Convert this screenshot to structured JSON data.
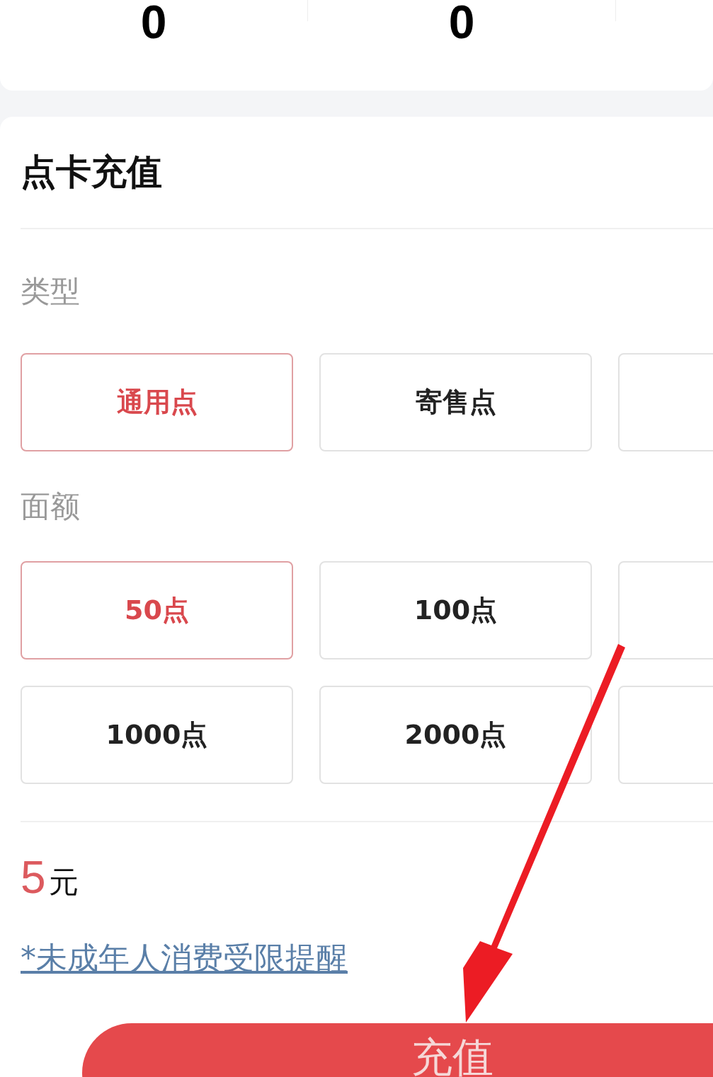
{
  "stats": [
    {
      "value": "0"
    },
    {
      "value": "0"
    }
  ],
  "recharge": {
    "title": "点卡充值",
    "type_label": "类型",
    "types": [
      {
        "label": "通用点",
        "selected": true
      },
      {
        "label": "寄售点",
        "selected": false
      },
      {
        "selected": false
      }
    ],
    "amount_label": "面额",
    "amounts": [
      {
        "label": "50点",
        "selected": true
      },
      {
        "label": "100点",
        "selected": false
      },
      {
        "selected": false
      },
      {
        "label": "1000点",
        "selected": false
      },
      {
        "label": "2000点",
        "selected": false
      },
      {
        "selected": false
      }
    ],
    "price": {
      "number": "5",
      "unit": "元"
    },
    "notice_link": "*未成年人消费受限提醒",
    "submit": "充值"
  }
}
